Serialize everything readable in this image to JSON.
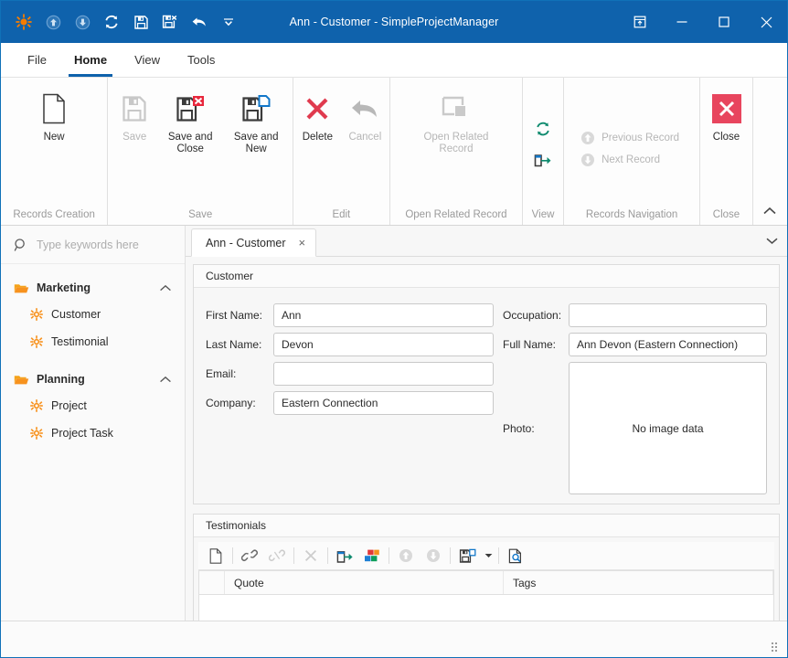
{
  "window": {
    "title": "Ann - Customer - SimpleProjectManager",
    "accent_color": "#0f62ac",
    "orange": "#f07f09",
    "quick_access": [
      {
        "name": "app-logo-icon",
        "label": "SimpleProjectManager"
      },
      {
        "name": "move-up-icon",
        "label": "Previous Record"
      },
      {
        "name": "move-down-icon",
        "label": "Next Record"
      },
      {
        "name": "refresh-icon",
        "label": "Refresh"
      },
      {
        "name": "save-icon",
        "label": "Save"
      },
      {
        "name": "save-and-close-icon",
        "label": "Save and Close"
      },
      {
        "name": "undo-icon",
        "label": "Undo"
      },
      {
        "name": "customize-quick-access-icon",
        "label": "Customize Quick Access Toolbar"
      }
    ],
    "controls": [
      {
        "name": "restore-ribbon-icon",
        "label": "Ribbon Display Options"
      },
      {
        "name": "minimize-icon",
        "label": "Minimize"
      },
      {
        "name": "maximize-icon",
        "label": "Maximize"
      },
      {
        "name": "close-icon",
        "label": "Close"
      }
    ]
  },
  "ribbon": {
    "tabs": [
      {
        "label": "File",
        "active": false
      },
      {
        "label": "Home",
        "active": true
      },
      {
        "label": "View",
        "active": false
      },
      {
        "label": "Tools",
        "active": false
      }
    ],
    "groups": [
      {
        "title": "Records Creation",
        "buttons": [
          {
            "label": "New",
            "enabled": true,
            "icon": "new-document-icon"
          }
        ]
      },
      {
        "title": "Save",
        "buttons": [
          {
            "label": "Save",
            "enabled": false,
            "icon": "save-icon"
          },
          {
            "label": "Save and Close",
            "enabled": true,
            "icon": "save-and-close-icon"
          },
          {
            "label": "Save and New",
            "enabled": true,
            "icon": "save-and-new-icon"
          }
        ]
      },
      {
        "title": "Edit",
        "buttons": [
          {
            "label": "Delete",
            "enabled": true,
            "icon": "delete-icon"
          },
          {
            "label": "Cancel",
            "enabled": false,
            "icon": "cancel-icon"
          }
        ]
      },
      {
        "title": "Open Related Record",
        "buttons": [
          {
            "label": "Open Related Record",
            "enabled": false,
            "icon": "open-related-record-icon"
          }
        ]
      },
      {
        "title": "View",
        "buttons": [
          {
            "label": "Refresh",
            "enabled": true,
            "icon": "refresh-icon"
          },
          {
            "label": "Open in New Window",
            "enabled": true,
            "icon": "open-new-window-icon"
          }
        ]
      },
      {
        "title": "Records Navigation",
        "buttons": [
          {
            "label": "Previous Record",
            "enabled": false,
            "icon": "previous-record-icon"
          },
          {
            "label": "Next Record",
            "enabled": false,
            "icon": "next-record-icon"
          }
        ]
      },
      {
        "title": "Close",
        "buttons": [
          {
            "label": "Close",
            "enabled": true,
            "icon": "close-red-icon"
          }
        ]
      }
    ],
    "collapse_label": "Collapse the Ribbon"
  },
  "sidebar": {
    "search": {
      "placeholder": "Type keywords here",
      "value": "",
      "icon": "search-icon"
    },
    "groups": [
      {
        "label": "Marketing",
        "expanded": true,
        "items": [
          {
            "label": "Customer"
          },
          {
            "label": "Testimonial"
          }
        ]
      },
      {
        "label": "Planning",
        "expanded": true,
        "items": [
          {
            "label": "Project"
          },
          {
            "label": "Project Task"
          }
        ]
      }
    ]
  },
  "main": {
    "tabs": [
      {
        "label": "Ann - Customer",
        "active": true,
        "close": "×"
      }
    ],
    "tabstrip_menu_icon": "chevron-down-icon",
    "customer_panel": {
      "title": "Customer",
      "fields_left": [
        {
          "label": "First Name:",
          "value": "Ann",
          "name": "first-name-field"
        },
        {
          "label": "Last Name:",
          "value": "Devon",
          "name": "last-name-field"
        },
        {
          "label": "Email:",
          "value": "",
          "name": "email-field"
        },
        {
          "label": "Company:",
          "value": "Eastern Connection",
          "name": "company-field"
        }
      ],
      "fields_right": [
        {
          "label": "Occupation:",
          "value": "",
          "name": "occupation-field"
        },
        {
          "label": "Full Name:",
          "value": "Ann Devon (Eastern Connection)",
          "name": "full-name-field"
        }
      ],
      "photo": {
        "label": "Photo:",
        "empty_text": "No image data"
      }
    },
    "testimonials_panel": {
      "title": "Testimonials",
      "toolbar": [
        {
          "name": "new-record-icon",
          "label": "New",
          "enabled": true
        },
        {
          "name": "link-icon",
          "label": "Link",
          "enabled": true
        },
        {
          "name": "unlink-icon",
          "label": "Unlink",
          "enabled": false
        },
        {
          "name": "delete-x-icon",
          "label": "Delete",
          "enabled": false
        },
        {
          "name": "open-new-window-icon",
          "label": "Open in New Window",
          "enabled": true
        },
        {
          "name": "show-in-report-icon",
          "label": "Analyze",
          "enabled": true
        },
        {
          "name": "move-up-icon",
          "label": "Move Up",
          "enabled": false
        },
        {
          "name": "move-down-icon",
          "label": "Move Down",
          "enabled": false
        },
        {
          "name": "export-icon",
          "label": "Export",
          "enabled": true
        },
        {
          "name": "preview-icon",
          "label": "Print Preview",
          "enabled": true
        }
      ],
      "columns": [
        "Quote",
        "Tags"
      ],
      "rows": []
    }
  },
  "statusbar": {
    "resize_grip_icon": "resize-grip-icon",
    "text": ""
  }
}
